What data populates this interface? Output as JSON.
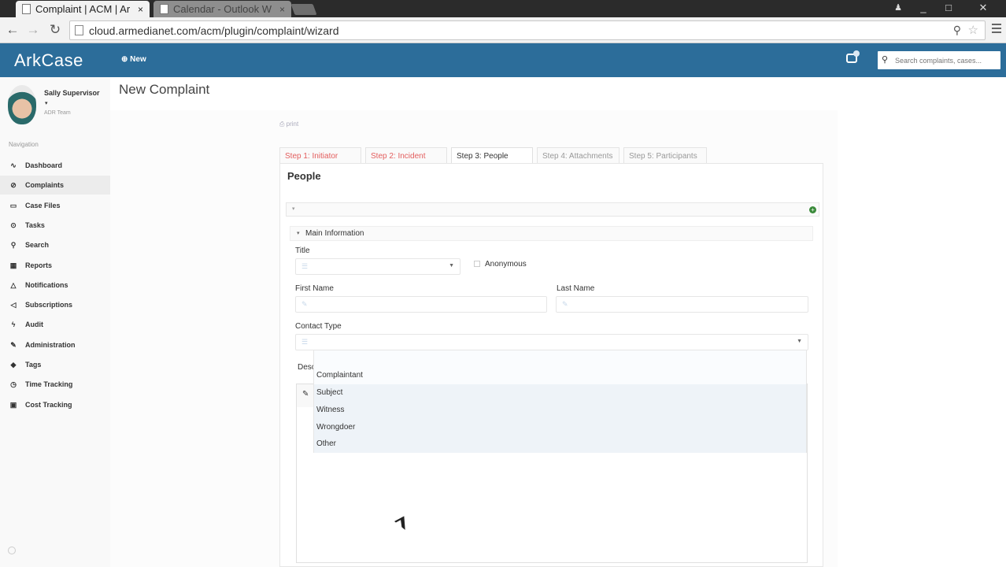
{
  "browser": {
    "tabs": [
      {
        "title": "Complaint | ACM | Ar",
        "close": "×"
      },
      {
        "title": "Calendar - Outlook W",
        "close": "×"
      }
    ],
    "url": "cloud.armedianet.com/acm/plugin/complaint/wizard",
    "window_controls": [
      "_",
      "□",
      "✕"
    ]
  },
  "header": {
    "logo": "ArkCase",
    "new_label": "New",
    "search_placeholder": "Search complaints, cases..."
  },
  "user": {
    "name": "Sally Supervisor",
    "caret": "▾",
    "team": "ADR Team"
  },
  "sidebar": {
    "nav_label": "Navigation",
    "items": [
      {
        "label": "Dashboard",
        "icon": "dashboard-icon",
        "glyph": "∿"
      },
      {
        "label": "Complaints",
        "icon": "complaints-icon",
        "glyph": "⊘"
      },
      {
        "label": "Case Files",
        "icon": "case-files-icon",
        "glyph": "▭"
      },
      {
        "label": "Tasks",
        "icon": "tasks-icon",
        "glyph": "⊙"
      },
      {
        "label": "Search",
        "icon": "search-icon",
        "glyph": "⚲"
      },
      {
        "label": "Reports",
        "icon": "reports-icon",
        "glyph": "▦"
      },
      {
        "label": "Notifications",
        "icon": "bell-icon",
        "glyph": "△"
      },
      {
        "label": "Subscriptions",
        "icon": "megaphone-icon",
        "glyph": "◁"
      },
      {
        "label": "Audit",
        "icon": "audit-icon",
        "glyph": "ϟ"
      },
      {
        "label": "Administration",
        "icon": "wrench-icon",
        "glyph": "✎"
      },
      {
        "label": "Tags",
        "icon": "tags-icon",
        "glyph": "◆"
      },
      {
        "label": "Time Tracking",
        "icon": "clock-icon",
        "glyph": "◷"
      },
      {
        "label": "Cost Tracking",
        "icon": "money-icon",
        "glyph": "▣"
      }
    ]
  },
  "page": {
    "title": "New Complaint",
    "print": "print",
    "steps": [
      {
        "label": "Step 1: Initiator",
        "state": "done"
      },
      {
        "label": "Step 2: Incident",
        "state": "done"
      },
      {
        "label": "Step 3: People",
        "state": "current"
      },
      {
        "label": "Step 4: Attachments",
        "state": "todo"
      },
      {
        "label": "Step 5: Participants",
        "state": "todo"
      }
    ],
    "panel_title": "People",
    "section_title": "Main Information",
    "form": {
      "title_label": "Title",
      "title_value": "",
      "anonymous_label": "Anonymous",
      "first_name_label": "First Name",
      "first_name_value": "",
      "last_name_label": "Last Name",
      "last_name_value": "",
      "contact_type_label": "Contact Type",
      "contact_type_value": "",
      "description_label": "Desc"
    },
    "contact_type_options": [
      "Complaintant",
      "Subject",
      "Witness",
      "Wrongdoer",
      "Other"
    ]
  }
}
